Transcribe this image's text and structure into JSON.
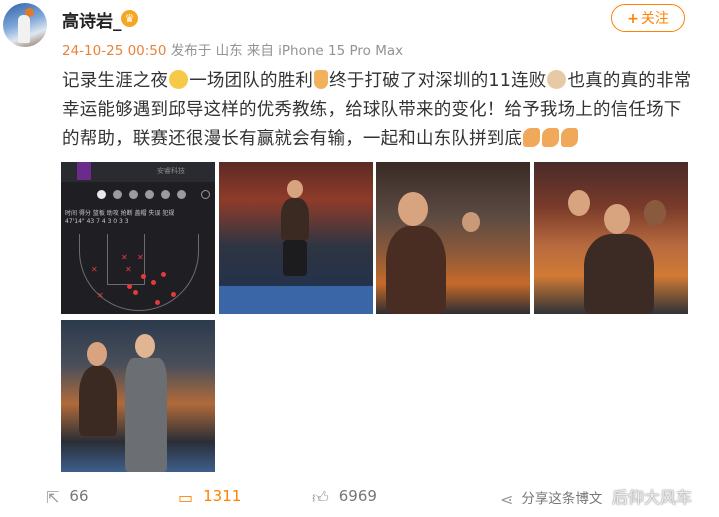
{
  "header": {
    "username": "高诗岩_",
    "timestamp": "24-10-25 00:50",
    "location": "发布于 山东",
    "device": "来自 iPhone 15 Pro Max",
    "follow_label": "关注",
    "follow_plus": "+"
  },
  "post": {
    "segments": [
      "记录生涯之夜",
      "一场团队的胜利",
      "终于打破了对深圳的11连败",
      "也真的真的非常幸运能够遇到邱导这样的优秀教练，给球队带来的变化！给予我场上的信任场下的帮助，联赛还很漫长有赢就会有输，一起和山东队拼到底"
    ]
  },
  "images": [
    {
      "name": "shot-chart",
      "stats_text": "时间  得分  篮板  助攻  抢断  盖帽  失误  犯规",
      "stats_values": "47'14\"  43   7    4    3    0    3    3",
      "brand": "安睿科技"
    },
    {
      "name": "player-photo-1"
    },
    {
      "name": "player-photo-2"
    },
    {
      "name": "team-celebration-photo"
    },
    {
      "name": "player-coach-photo"
    }
  ],
  "footer": {
    "share_count": "66",
    "comment_count": "1311",
    "like_count": "6969",
    "share_label": "分享这条博文"
  },
  "watermark": "后仰大风车",
  "colors": {
    "accent": "#ff8200",
    "time": "#e8833a",
    "meta": "#939393"
  }
}
